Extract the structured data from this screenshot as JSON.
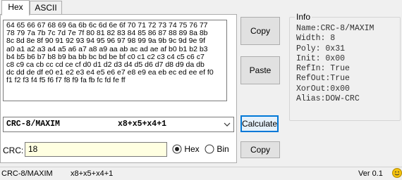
{
  "tabs": [
    {
      "label": "Hex"
    },
    {
      "label": "ASCII"
    }
  ],
  "hex_lines": [
    "64 65 66 67 68 69 6a 6b 6c 6d 6e 6f 70 71 72 73 74 75 76 77",
    "78 79 7a 7b 7c 7d 7e 7f 80 81 82 83 84 85 86 87 88 89 8a 8b",
    "8c 8d 8e 8f 90 91 92 93 94 95 96 97 98 99 9a 9b 9c 9d 9e 9f",
    "a0 a1 a2 a3 a4 a5 a6 a7 a8 a9 aa ab ac ad ae af b0 b1 b2 b3",
    "b4 b5 b6 b7 b8 b9 ba bb bc bd be bf c0 c1 c2 c3 c4 c5 c6 c7",
    "c8 c9 ca cb cc cd ce cf d0 d1 d2 d3 d4 d5 d6 d7 d8 d9 da db",
    "dc dd de df e0 e1 e2 e3 e4 e5 e6 e7 e8 e9 ea eb ec ed ee ef f0",
    "f1 f2 f3 f4 f5 f6 f7 f8 f9 fa fb fc fd fe ff"
  ],
  "buttons": {
    "copy_top": "Copy",
    "paste": "Paste",
    "calculate": "Calculate",
    "copy_bottom": "Copy"
  },
  "info": {
    "title": "Info",
    "lines": [
      "Name:CRC-8/MAXIM",
      "Width: 8",
      "Poly:  0x31",
      "Init:  0x00",
      "RefIn: True",
      "RefOut:True",
      "XorOut:0x00",
      "Alias:DOW-CRC"
    ]
  },
  "algorithm_select": {
    "name": "CRC-8/MAXIM",
    "polynomial": "x8+x5+x4+1"
  },
  "crc": {
    "label": "CRC:",
    "value": "18"
  },
  "format": {
    "hex_label": "Hex",
    "bin_label": "Bin",
    "selected": "Hex"
  },
  "status_bar": {
    "name": "CRC-8/MAXIM",
    "polynomial": "x8+x5+x4+1",
    "version": "Ver 0.1"
  },
  "icons": {
    "status": "smiley-icon"
  }
}
